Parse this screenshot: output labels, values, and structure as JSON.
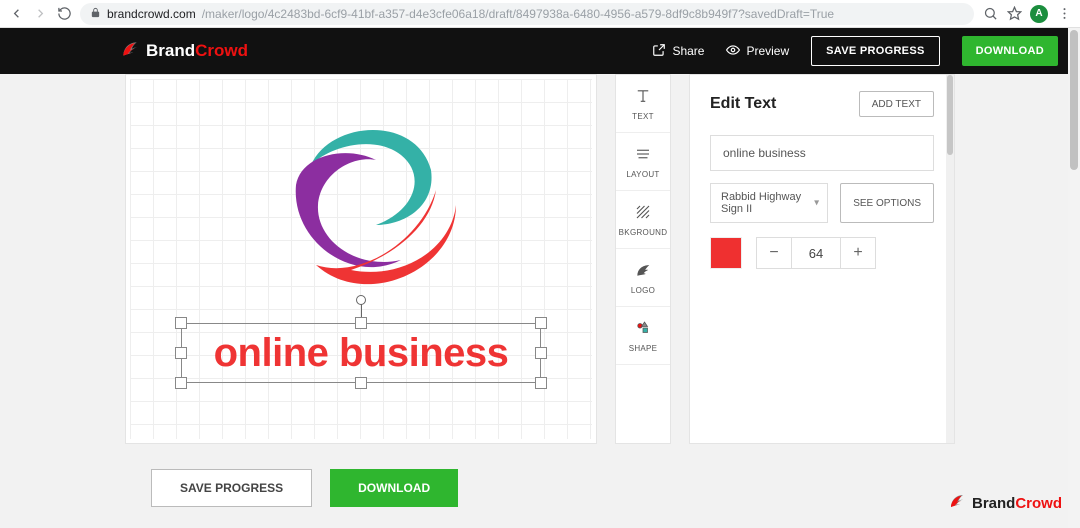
{
  "browser": {
    "url_host": "brandcrowd.com",
    "url_path": "/maker/logo/4c2483bd-6cf9-41bf-a357-d4e3cfe06a18/draft/8497938a-6480-4956-a579-8df9c8b949f7?savedDraft=True",
    "avatar_letter": "A"
  },
  "header": {
    "brand_part1": "Brand",
    "brand_part2": "Crowd",
    "share": "Share",
    "preview": "Preview",
    "save_progress": "SAVE PROGRESS",
    "download": "DOWNLOAD"
  },
  "tools": {
    "text": "TEXT",
    "layout": "LAYOUT",
    "bkground": "BKGROUND",
    "logo": "LOGO",
    "shape": "SHAPE"
  },
  "canvas": {
    "logo_text": "online business",
    "text_color": "#ef3434"
  },
  "panel": {
    "title": "Edit Text",
    "add_text": "ADD TEXT",
    "text_value": "online business",
    "font_name": "Rabbid Highway Sign II",
    "see_options": "SEE OPTIONS",
    "swatch_color": "#ef3030",
    "font_size": "64"
  },
  "bottom": {
    "save_progress": "SAVE PROGRESS",
    "download": "DOWNLOAD"
  },
  "footer": {
    "brand_part1": "Brand",
    "brand_part2": "Crowd"
  }
}
